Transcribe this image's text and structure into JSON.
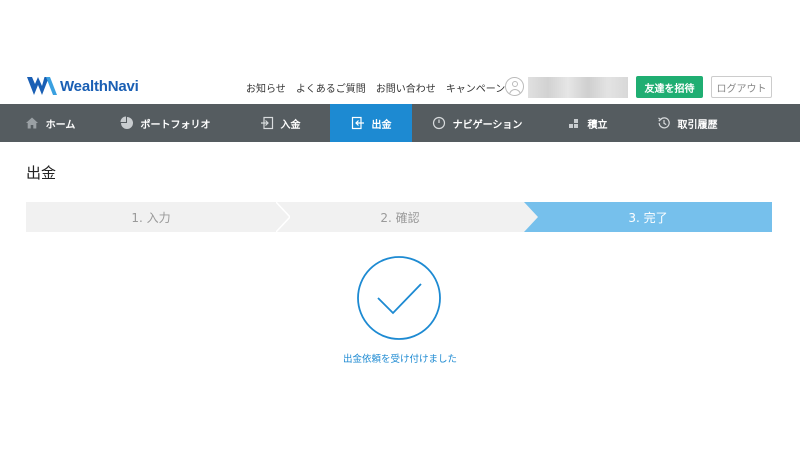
{
  "brand": {
    "name": "WealthNavi",
    "color": "#1a5fb4"
  },
  "header": {
    "links": [
      "お知らせ",
      "よくあるご質問",
      "お問い合わせ",
      "キャンペーン"
    ],
    "invite_label": "友達を招待",
    "logout_label": "ログアウト"
  },
  "nav": {
    "items": [
      {
        "label": "ホーム",
        "icon": "home-icon",
        "active": false
      },
      {
        "label": "ポートフォリオ",
        "icon": "pie-chart-icon",
        "active": false
      },
      {
        "label": "入金",
        "icon": "deposit-icon",
        "active": false
      },
      {
        "label": "出金",
        "icon": "withdraw-icon",
        "active": true
      },
      {
        "label": "ナビゲーション",
        "icon": "gauge-icon",
        "active": false
      },
      {
        "label": "積立",
        "icon": "blocks-icon",
        "active": false
      },
      {
        "label": "取引履歴",
        "icon": "history-icon",
        "active": false
      }
    ],
    "active_color": "#1d8ad2",
    "bg_color": "#555c60"
  },
  "page": {
    "title": "出金",
    "steps": [
      "1. 入力",
      "2. 確認",
      "3. 完了"
    ],
    "current_step": 3,
    "completion_message": "出金依頼を受け付けました"
  }
}
